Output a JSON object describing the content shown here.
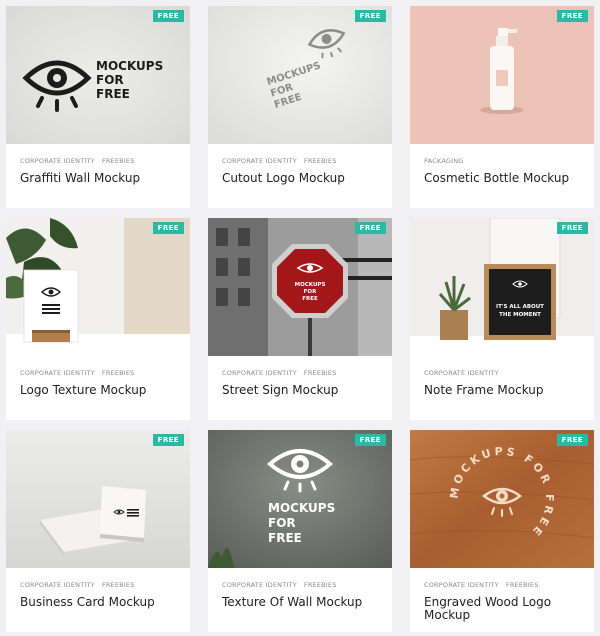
{
  "badge_label": "FREE",
  "cards": [
    {
      "categories": [
        "CORPORATE IDENTITY",
        "FREEBIES"
      ],
      "title": "Graffiti Wall Mockup",
      "art_text": [
        "MOCKUPS",
        "FOR",
        "FREE"
      ]
    },
    {
      "categories": [
        "CORPORATE IDENTITY",
        "FREEBIES"
      ],
      "title": "Cutout Logo Mockup",
      "art_text": [
        "MOCKUPS",
        "FOR",
        "FREE"
      ]
    },
    {
      "categories": [
        "PACKAGING"
      ],
      "title": "Cosmetic Bottle Mockup"
    },
    {
      "categories": [
        "CORPORATE IDENTITY",
        "FREEBIES"
      ],
      "title": "Logo Texture Mockup"
    },
    {
      "categories": [
        "CORPORATE IDENTITY",
        "FREEBIES"
      ],
      "title": "Street Sign Mockup",
      "art_text": [
        "MOCKUPS",
        "FOR",
        "FREE"
      ]
    },
    {
      "categories": [
        "CORPORATE IDENTITY"
      ],
      "title": "Note Frame Mockup",
      "art_text": [
        "IT'S ALL ABOUT",
        "THE MOMENT"
      ]
    },
    {
      "categories": [
        "CORPORATE IDENTITY",
        "FREEBIES"
      ],
      "title": "Business Card Mockup"
    },
    {
      "categories": [
        "CORPORATE IDENTITY",
        "FREEBIES"
      ],
      "title": "Texture Of Wall Mockup",
      "art_text": [
        "MOCKUPS",
        "FOR",
        "FREE"
      ]
    },
    {
      "categories": [
        "CORPORATE IDENTITY",
        "FREEBIES"
      ],
      "title": "Engraved Wood Logo Mockup",
      "art_text": [
        "MOCKUPS FOR FREE"
      ]
    }
  ],
  "colors": {
    "badge": "#2fb7a6",
    "title": "#222226",
    "category": "#8a8a8e",
    "page_bg": "#f1f1f3"
  }
}
